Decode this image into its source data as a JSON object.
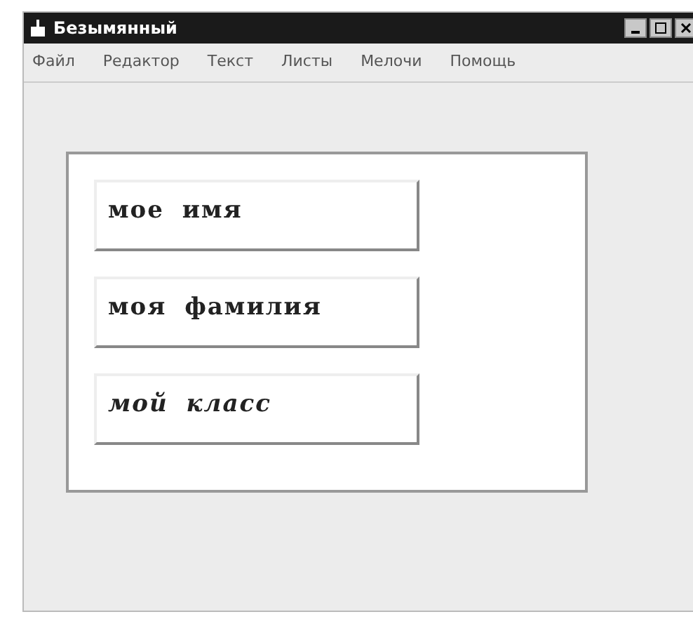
{
  "window": {
    "title": "Безымянный"
  },
  "menu": [
    {
      "label": "Файл"
    },
    {
      "label": "Редактор"
    },
    {
      "label": "Текст"
    },
    {
      "label": "Листы"
    },
    {
      "label": "Мелочи"
    },
    {
      "label": "Помощь"
    }
  ],
  "fields": [
    {
      "value": "мое имя",
      "italic": false
    },
    {
      "value": "моя фамилия",
      "italic": false
    },
    {
      "value": "мой класс",
      "italic": true
    }
  ]
}
